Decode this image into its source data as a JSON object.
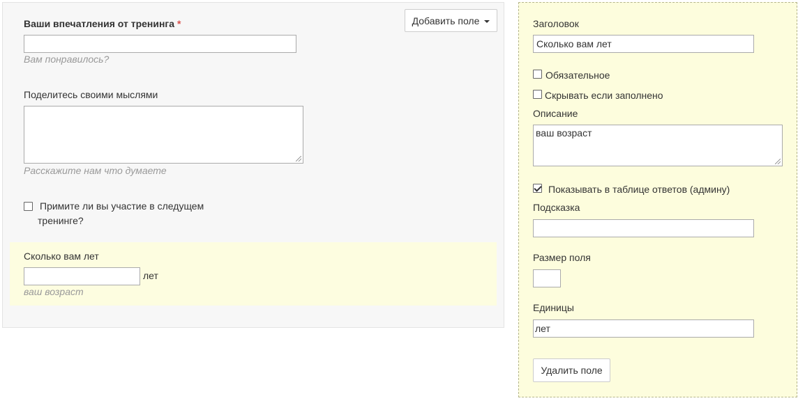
{
  "form": {
    "add_field_label": "Добавить поле",
    "impressions": {
      "label": "Ваши впечатления от тренинга",
      "required_mark": "*",
      "value": "",
      "hint": "Вам понравилось?"
    },
    "thoughts": {
      "label": "Поделитесь своими мыслями",
      "value": "",
      "hint": "Расскажите нам что думаете"
    },
    "participation": {
      "label_line1": "Примите ли вы участие в следущем",
      "label_line2": "тренинге?",
      "checked": false
    },
    "age": {
      "label": "Сколько вам лет",
      "value": "",
      "units": "лет",
      "hint": "ваш возраст"
    }
  },
  "settings": {
    "title_label": "Заголовок",
    "title_value": "Сколько вам лет",
    "required_label": "Обязательное",
    "hide_if_filled_label": "Скрывать если заполнено",
    "description_label": "Описание",
    "description_value": "ваш возраст",
    "show_in_table_label": "Показывать в таблице ответов (админу)",
    "hint_label": "Подсказка",
    "hint_value": "",
    "size_label": "Размер поля",
    "size_value": "",
    "units_label": "Единицы",
    "units_value": "лет",
    "delete_label": "Удалить поле"
  },
  "colors": {
    "highlight": "#fdfde0",
    "required": "#d9534f",
    "hint_text": "#999999"
  }
}
